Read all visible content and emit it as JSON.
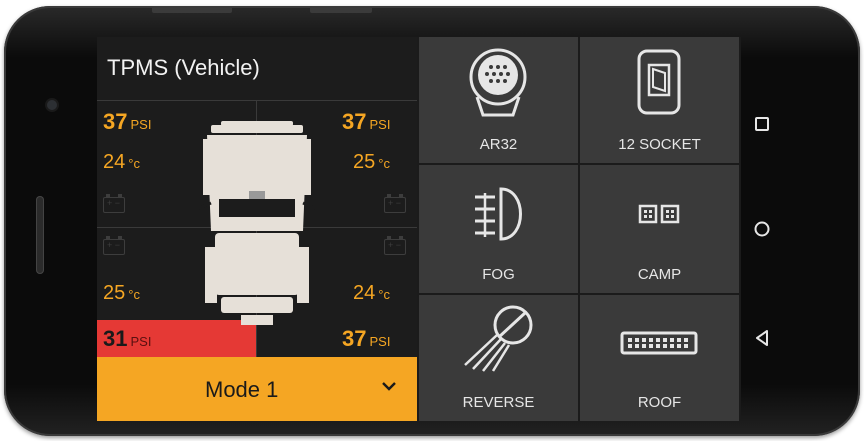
{
  "panel": {
    "title": "TPMS (Vehicle)",
    "unit_pressure": "PSI",
    "unit_temp": "°c",
    "front_left": {
      "pressure": "37",
      "temp": "24"
    },
    "front_right": {
      "pressure": "37",
      "temp": "25"
    },
    "rear_left": {
      "pressure": "31",
      "temp": "25",
      "alert": true
    },
    "rear_right": {
      "pressure": "37",
      "temp": "24"
    },
    "battery_symbol": "+ −"
  },
  "mode": {
    "label": "Mode 1"
  },
  "tiles": [
    {
      "label": "AR32",
      "icon": "spotlight-icon"
    },
    {
      "label": "12 SOCKET",
      "icon": "socket-switch-icon"
    },
    {
      "label": "FOG",
      "icon": "fog-light-icon"
    },
    {
      "label": "CAMP",
      "icon": "camp-light-icon"
    },
    {
      "label": "REVERSE",
      "icon": "reverse-light-icon"
    },
    {
      "label": "ROOF",
      "icon": "roof-light-bar-icon"
    }
  ],
  "colors": {
    "accent": "#f5a623",
    "alert": "#e53935",
    "tile_bg": "#3a3a3a",
    "panel_bg": "#1c1c1c"
  },
  "navigation": {
    "recent": "square-icon",
    "home": "circle-icon",
    "back": "triangle-back-icon"
  }
}
